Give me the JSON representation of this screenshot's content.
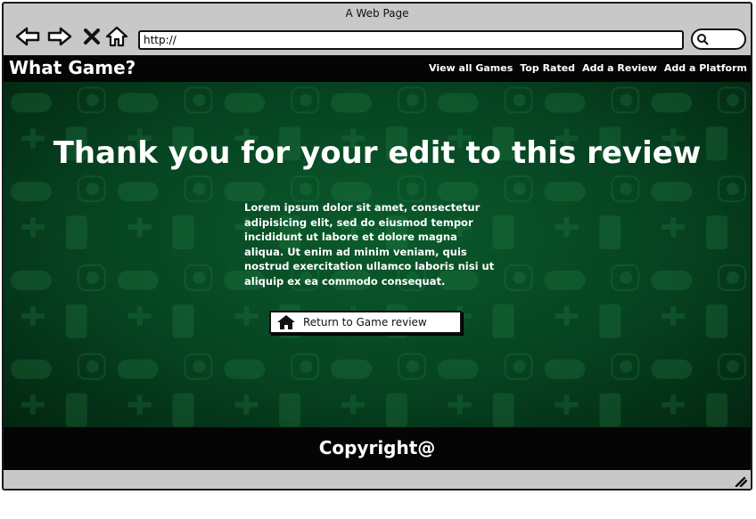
{
  "window": {
    "title": "A Web Page"
  },
  "browser": {
    "url": "http://",
    "icons": [
      "back-arrow-icon",
      "forward-arrow-icon",
      "close-x-icon",
      "home-icon",
      "search-icon"
    ]
  },
  "header": {
    "brand": "What Game?",
    "menu": [
      "View all Games",
      "Top Rated",
      "Add a Review",
      "Add a Platform"
    ]
  },
  "main": {
    "heading": "Thank you for your edit to this review",
    "body": "Lorem ipsum dolor sit amet, consectetur adipisicing elit, sed do eiusmod tempor incididunt ut labore et dolore magna aliqua. Ut enim ad minim veniam, quis nostrud exercitation ullamco laboris nisi ut aliquip ex ea commodo consequat.",
    "return_button": "Return to Game review"
  },
  "footer": {
    "text": "Copyright@"
  },
  "colors": {
    "hero": "#064321",
    "bars": "#050505",
    "chrome": "#c8c8c8"
  }
}
